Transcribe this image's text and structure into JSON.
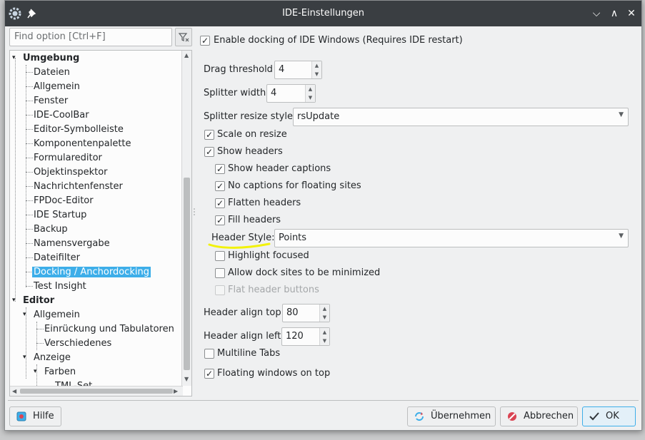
{
  "window": {
    "title": "IDE-Einstellungen"
  },
  "search": {
    "placeholder": "Find option [Ctrl+F]"
  },
  "tree": {
    "items": [
      {
        "label": "Umgebung",
        "bold": true
      },
      {
        "label": "Dateien"
      },
      {
        "label": "Allgemein"
      },
      {
        "label": "Fenster"
      },
      {
        "label": "IDE-CoolBar"
      },
      {
        "label": "Editor-Symbolleiste"
      },
      {
        "label": "Komponentenpalette"
      },
      {
        "label": "Formulareditor"
      },
      {
        "label": "Objektinspektor"
      },
      {
        "label": "Nachrichtenfenster"
      },
      {
        "label": "FPDoc-Editor"
      },
      {
        "label": "IDE Startup"
      },
      {
        "label": "Backup"
      },
      {
        "label": "Namensvergabe"
      },
      {
        "label": "Dateifilter"
      },
      {
        "label": "Docking / Anchordocking",
        "selected": true
      },
      {
        "label": "Test Insight"
      },
      {
        "label": "Editor",
        "bold": true
      },
      {
        "label": "Allgemein"
      },
      {
        "label": "Einrückung und Tabulatoren"
      },
      {
        "label": "Verschiedenes"
      },
      {
        "label": "Anzeige"
      },
      {
        "label": "Farben"
      },
      {
        "label": "TML-Set..."
      }
    ]
  },
  "settings": {
    "enable_docking": {
      "label": "Enable docking of IDE Windows (Requires IDE restart)",
      "checked": true
    },
    "drag_threshold": {
      "label": "Drag threshold",
      "value": "4"
    },
    "splitter_width": {
      "label": "Splitter width",
      "value": "4"
    },
    "splitter_resize_style": {
      "label": "Splitter resize style:",
      "value": "rsUpdate"
    },
    "scale_on_resize": {
      "label": "Scale on resize",
      "checked": true
    },
    "show_headers": {
      "label": "Show headers",
      "checked": true
    },
    "show_header_captions": {
      "label": "Show header captions",
      "checked": true
    },
    "no_captions_floating": {
      "label": "No captions for floating sites",
      "checked": true
    },
    "flatten_headers": {
      "label": "Flatten headers",
      "checked": true
    },
    "fill_headers": {
      "label": "Fill headers",
      "checked": true
    },
    "header_style": {
      "label": "Header Style:",
      "value": "Points"
    },
    "highlight_focused": {
      "label": "Highlight focused",
      "checked": false
    },
    "allow_minimized": {
      "label": "Allow dock sites to be minimized",
      "checked": false
    },
    "flat_header_buttons": {
      "label": "Flat header buttons",
      "checked": false,
      "disabled": true
    },
    "header_align_top": {
      "label": "Header align top",
      "value": "80"
    },
    "header_align_left": {
      "label": "Header align left",
      "value": "120"
    },
    "multiline_tabs": {
      "label": "Multiline Tabs",
      "checked": false
    },
    "floating_on_top": {
      "label": "Floating windows on top",
      "checked": true
    }
  },
  "buttons": {
    "help": "Hilfe",
    "apply": "Übernehmen",
    "cancel": "Abbrechen",
    "ok": "OK"
  },
  "colors": {
    "titlebar": "#3a3e42",
    "selection": "#3daee9",
    "annotation": "#f2f20a"
  }
}
